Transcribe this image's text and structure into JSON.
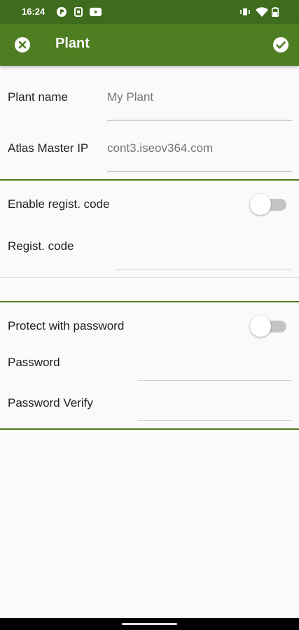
{
  "status_bar": {
    "time": "16:24",
    "left_icons": [
      "app-p-icon",
      "sync-icon",
      "youtube-icon"
    ],
    "right_icons": [
      "vibrate-icon",
      "wifi-icon",
      "battery-icon"
    ]
  },
  "app_bar": {
    "title": "Plant",
    "close_icon": "close-circle-icon",
    "confirm_icon": "check-circle-icon",
    "color": "#4f7d21"
  },
  "section_plant": {
    "plant_name_label": "Plant name",
    "plant_name_value": "My Plant",
    "atlas_master_ip_label": "Atlas Master IP",
    "atlas_master_ip_value": "cont3.iseov364.com"
  },
  "section_regist": {
    "enable_label": "Enable regist. code",
    "enable_on": false,
    "code_label": "Regist. code",
    "code_value": ""
  },
  "section_password": {
    "protect_label": "Protect with password",
    "protect_on": false,
    "password_label": "Password",
    "password_value": "",
    "verify_label": "Password Verify",
    "verify_value": ""
  }
}
